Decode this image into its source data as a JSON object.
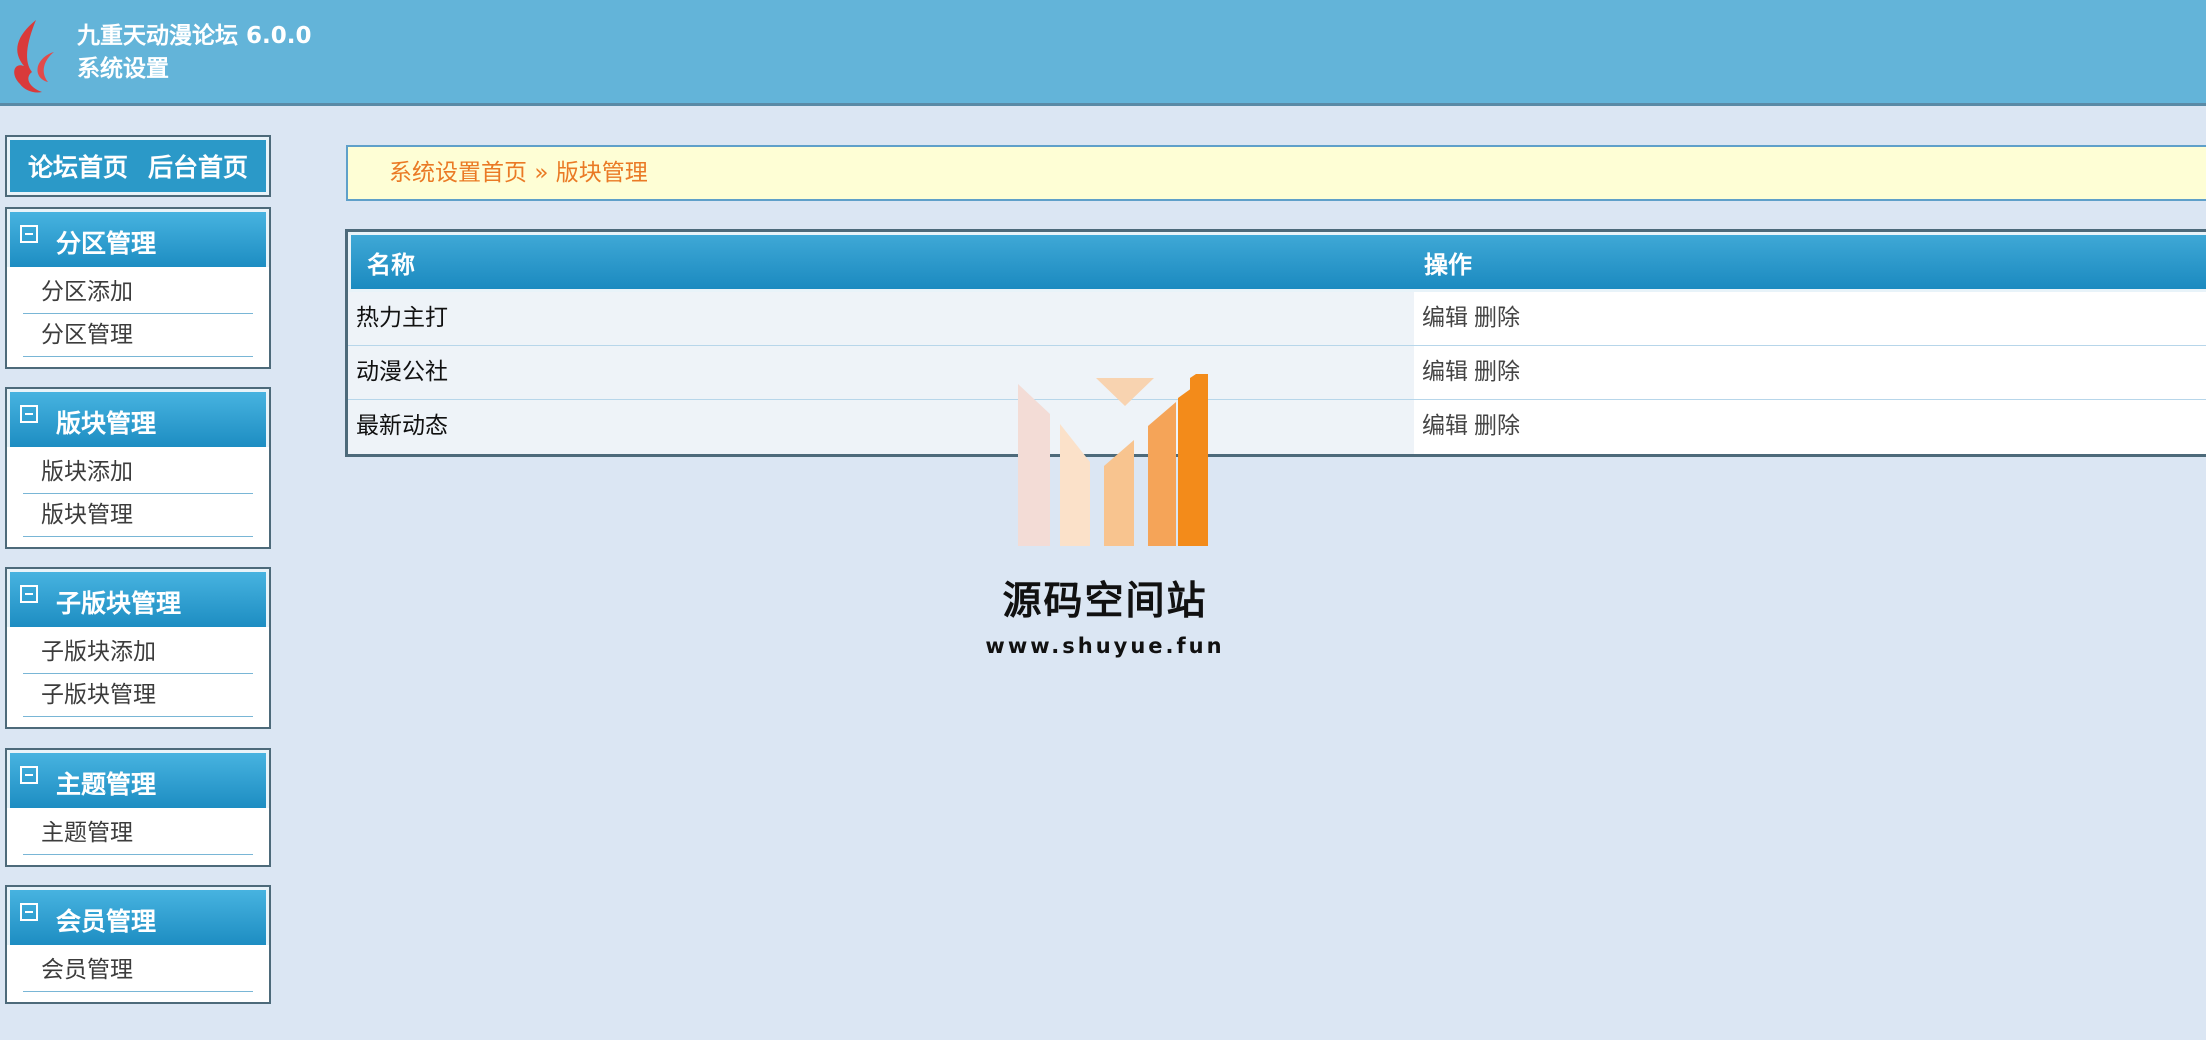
{
  "header": {
    "app_name": "九重天动漫论坛 6.0.0",
    "subtitle": "系统设置"
  },
  "sidebar": {
    "top_links": [
      {
        "label": "论坛首页"
      },
      {
        "label": "后台首页"
      }
    ],
    "groups": [
      {
        "title": "分区管理",
        "items": [
          "分区添加",
          "分区管理"
        ]
      },
      {
        "title": "版块管理",
        "items": [
          "版块添加",
          "版块管理"
        ]
      },
      {
        "title": "子版块管理",
        "items": [
          "子版块添加",
          "子版块管理"
        ]
      },
      {
        "title": "主题管理",
        "items": [
          "主题管理"
        ]
      },
      {
        "title": "会员管理",
        "items": [
          "会员管理"
        ]
      }
    ]
  },
  "breadcrumb": {
    "home": "系统设置首页",
    "separator": "»",
    "current": "版块管理"
  },
  "table": {
    "columns": [
      "名称",
      "操作"
    ],
    "rows": [
      {
        "name": "热力主打",
        "actions": [
          "编辑",
          "删除"
        ]
      },
      {
        "name": "动漫公社",
        "actions": [
          "编辑",
          "删除"
        ]
      },
      {
        "name": "最新动态",
        "actions": [
          "编辑",
          "删除"
        ]
      }
    ]
  },
  "watermark": {
    "title": "源码空间站",
    "url": "www.shuyue.fun"
  },
  "colors": {
    "header_bg": "#63b4d9",
    "page_bg": "#dbe6f3",
    "accent_blue": "#1d8dc2",
    "breadcrumb_text": "#ea7a25",
    "breadcrumb_bg": "#fefed5",
    "logo_red": "#d93a3a",
    "watermark_orange": "#f38b1a"
  },
  "icons": {
    "logo": "flame-logo-icon",
    "group_toggle": "collapse-minus-icon",
    "watermark": "bar-chart-logo-icon"
  }
}
